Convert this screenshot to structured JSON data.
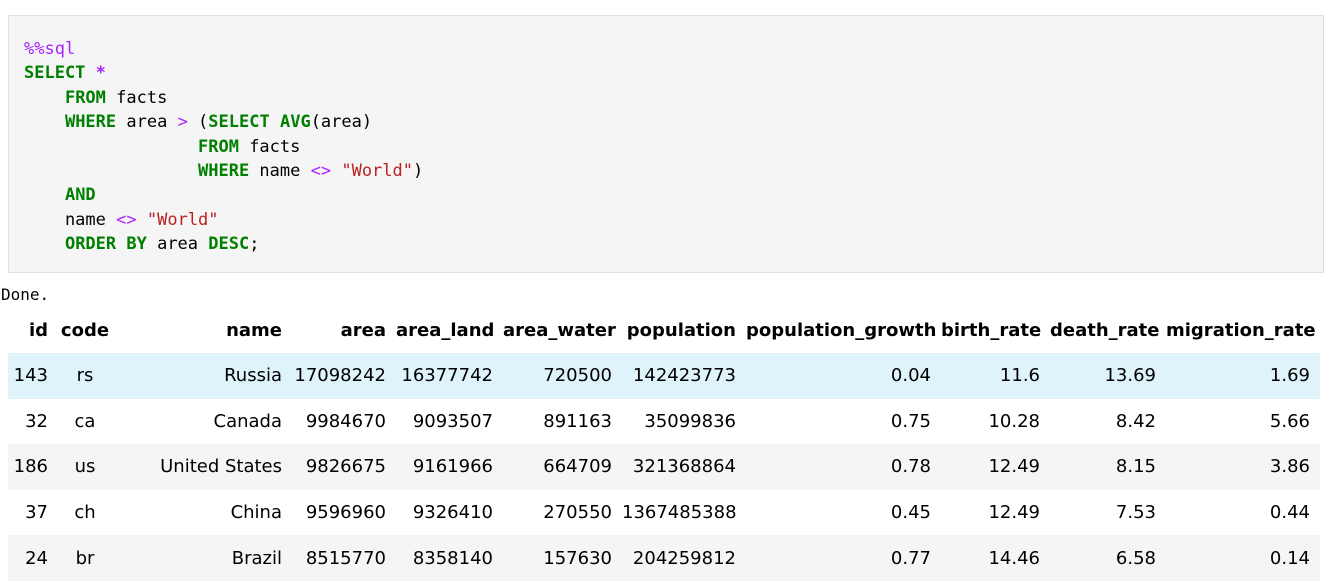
{
  "cell": {
    "magic": "%%sql",
    "code_lines": [
      [
        {
          "t": "kw",
          "v": "SELECT"
        },
        {
          "t": "tx",
          "v": " "
        },
        {
          "t": "op",
          "v": "*"
        }
      ],
      [
        {
          "t": "tx",
          "v": "    "
        },
        {
          "t": "kw",
          "v": "FROM"
        },
        {
          "t": "tx",
          "v": " facts"
        }
      ],
      [
        {
          "t": "tx",
          "v": "    "
        },
        {
          "t": "kw",
          "v": "WHERE"
        },
        {
          "t": "tx",
          "v": " area "
        },
        {
          "t": "mg",
          "v": ">"
        },
        {
          "t": "tx",
          "v": " ("
        },
        {
          "t": "kw",
          "v": "SELECT"
        },
        {
          "t": "tx",
          "v": " "
        },
        {
          "t": "kw",
          "v": "AVG"
        },
        {
          "t": "tx",
          "v": "(area)"
        }
      ],
      [
        {
          "t": "tx",
          "v": "                 "
        },
        {
          "t": "kw",
          "v": "FROM"
        },
        {
          "t": "tx",
          "v": " facts"
        }
      ],
      [
        {
          "t": "tx",
          "v": "                 "
        },
        {
          "t": "kw",
          "v": "WHERE"
        },
        {
          "t": "tx",
          "v": " name "
        },
        {
          "t": "mg",
          "v": "<>"
        },
        {
          "t": "tx",
          "v": " "
        },
        {
          "t": "str",
          "v": "\"World\""
        },
        {
          "t": "tx",
          "v": ")"
        }
      ],
      [
        {
          "t": "tx",
          "v": "    "
        },
        {
          "t": "kw",
          "v": "AND"
        }
      ],
      [
        {
          "t": "tx",
          "v": "    name "
        },
        {
          "t": "mg",
          "v": "<>"
        },
        {
          "t": "tx",
          "v": " "
        },
        {
          "t": "str",
          "v": "\"World\""
        }
      ],
      [
        {
          "t": "tx",
          "v": "    "
        },
        {
          "t": "kw",
          "v": "ORDER BY"
        },
        {
          "t": "tx",
          "v": " area "
        },
        {
          "t": "kw",
          "v": "DESC"
        },
        {
          "t": "tx",
          "v": ";"
        }
      ]
    ]
  },
  "output": {
    "status": "Done."
  },
  "table": {
    "columns": [
      "id",
      "code",
      "name",
      "area",
      "area_land",
      "area_water",
      "population",
      "population_growth",
      "birth_rate",
      "death_rate",
      "migration_rate"
    ],
    "rows": [
      [
        "143",
        "rs",
        "Russia",
        "17098242",
        "16377742",
        "720500",
        "142423773",
        "0.04",
        "11.6",
        "13.69",
        "1.69"
      ],
      [
        "32",
        "ca",
        "Canada",
        "9984670",
        "9093507",
        "891163",
        "35099836",
        "0.75",
        "10.28",
        "8.42",
        "5.66"
      ],
      [
        "186",
        "us",
        "United States",
        "9826675",
        "9161966",
        "664709",
        "321368864",
        "0.78",
        "12.49",
        "8.15",
        "3.86"
      ],
      [
        "37",
        "ch",
        "China",
        "9596960",
        "9326410",
        "270550",
        "1367485388",
        "0.45",
        "12.49",
        "7.53",
        "0.44"
      ],
      [
        "24",
        "br",
        "Brazil",
        "8515770",
        "8358140",
        "157630",
        "204259812",
        "0.77",
        "14.46",
        "6.58",
        "0.14"
      ]
    ],
    "hovered_row": 0
  },
  "colors": {
    "keyword": "#008000",
    "operator": "#aa22ff",
    "string": "#ba2121",
    "cell_bg": "#f5f5f5",
    "row_hover": "#dff3fb"
  }
}
